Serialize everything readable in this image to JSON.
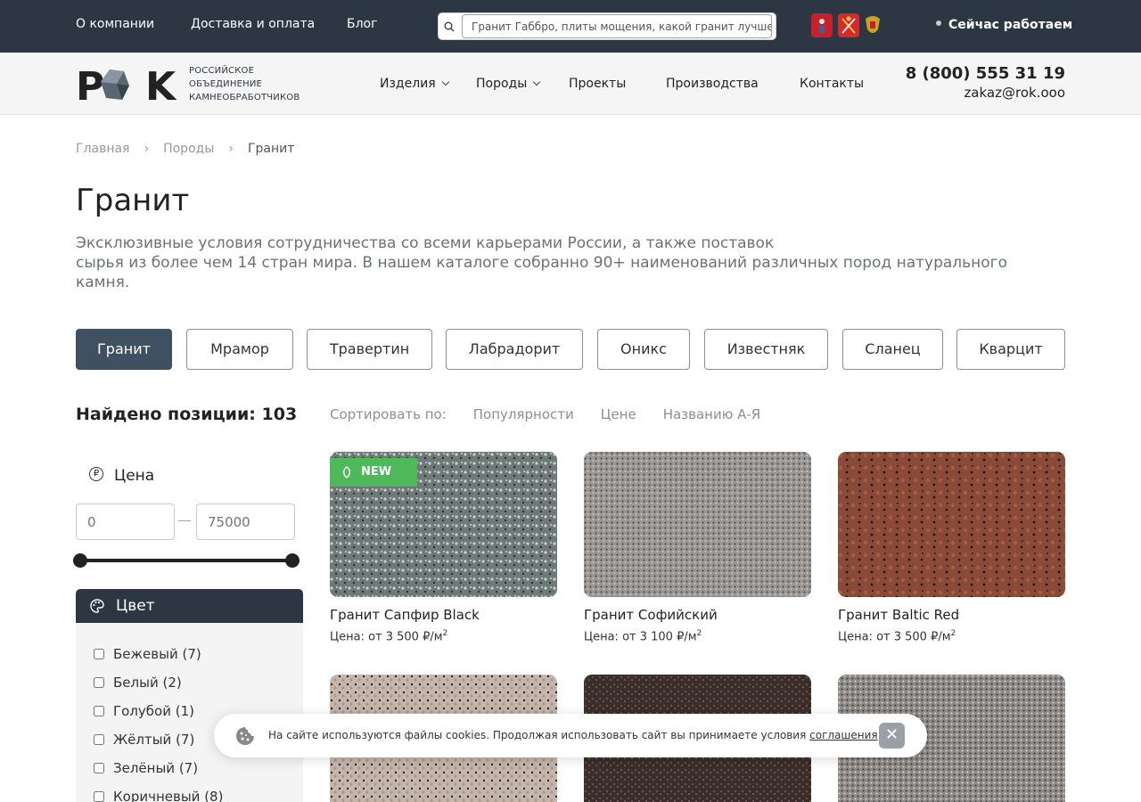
{
  "topbar": {
    "links": [
      "О компании",
      "Доставка и оплата",
      "Блог"
    ],
    "search_value": "Гранит Габбро, плиты мощения, какой гранит лучше",
    "status": "Сейчас работаем"
  },
  "header": {
    "logo_text": "РОК",
    "logo_sub": [
      "РОССИЙСКОЕ",
      "ОБЪЕДИНЕНИЕ",
      "КАМНЕОБРАБОТЧИКОВ"
    ],
    "nav": [
      "Изделия",
      "Породы",
      "Проекты",
      "Производства",
      "Контакты"
    ],
    "phone": "8 (800) 555 31 19",
    "email": "zakaz@rok.ooo"
  },
  "breadcrumb": [
    "Главная",
    "Породы",
    "Гранит"
  ],
  "page": {
    "title": "Гранит",
    "intro_line1": "Эксклюзивные условия сотрудничества со всеми карьерами России, а также поставок",
    "intro_line2": "сырья из более чем 14 стран мира. В нашем каталоге собранно 90+ наименований различных пород натурального камня."
  },
  "rock_tabs": [
    "Гранит",
    "Мрамор",
    "Травертин",
    "Лабрадорит",
    "Оникс",
    "Известняк",
    "Сланец",
    "Кварцит"
  ],
  "found_label": "Найдено позиции: 103",
  "sort": {
    "label": "Сортировать по:",
    "options": [
      "Популярности",
      "Цене",
      "Названию А-Я"
    ]
  },
  "filters": {
    "price_title": "Цена",
    "price_min": "0",
    "price_max": "75000",
    "color_title": "Цвет",
    "colors": [
      "Бежевый (7)",
      "Белый (2)",
      "Голубой (1)",
      "Жёлтый (7)",
      "Зелёный (7)",
      "Коричневый (8)"
    ]
  },
  "products": [
    {
      "name": "Гранит Сапфир Black",
      "price": "Цена: от 3 500 ₽/м",
      "badge": "NEW",
      "color": "#6f7a78"
    },
    {
      "name": "Гранит Софийский",
      "price": "Цена: от 3 100 ₽/м",
      "color": "#9a9693"
    },
    {
      "name": "Гранит Baltic Red",
      "price": "Цена: от 3 500 ₽/м",
      "color": "#8a4a38"
    },
    {
      "name": "",
      "price": "",
      "color": "#c4b6ab"
    },
    {
      "name": "",
      "price": "",
      "color": "#3a2d2a"
    },
    {
      "name": "",
      "price": "",
      "color": "#8e8a87"
    }
  ],
  "price_unit_sup": "2",
  "cookie": {
    "text": "На сайте используются файлы cookies. Продолжая использовать сайт вы принимаете условия ",
    "link": "соглашения",
    "close": "✕"
  }
}
